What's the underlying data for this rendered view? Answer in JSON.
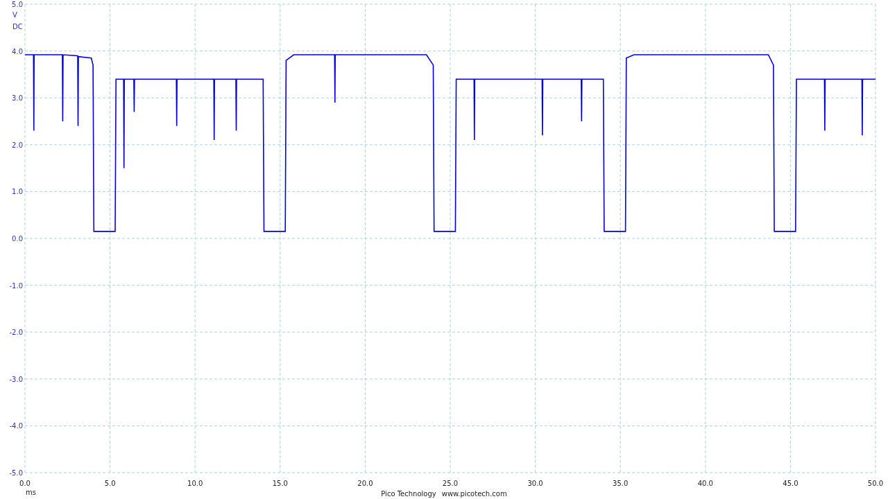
{
  "scope": {
    "coupling": "DC",
    "chart_data": {
      "type": "line",
      "grid": true,
      "xlabel": "ms",
      "ylabel": "V",
      "xlim": [
        0,
        50
      ],
      "ylim": [
        -5,
        5
      ],
      "xticks": [
        {
          "value": 0,
          "label": "0.0"
        },
        {
          "value": 5,
          "label": "5.0"
        },
        {
          "value": 10,
          "label": "10.0"
        },
        {
          "value": 15,
          "label": "15.0"
        },
        {
          "value": 20,
          "label": "20.0"
        },
        {
          "value": 25,
          "label": "25.0"
        },
        {
          "value": 30,
          "label": "30.0"
        },
        {
          "value": 35,
          "label": "35.0"
        },
        {
          "value": 40,
          "label": "40.0"
        },
        {
          "value": 45,
          "label": "45.0"
        },
        {
          "value": 50,
          "label": "50.0"
        }
      ],
      "yticks": [
        {
          "value": 5,
          "label": "5.0"
        },
        {
          "value": 4,
          "label": "4.0"
        },
        {
          "value": 3,
          "label": "3.0"
        },
        {
          "value": 2,
          "label": "2.0"
        },
        {
          "value": 1,
          "label": "1.0"
        },
        {
          "value": 0,
          "label": "0.0"
        },
        {
          "value": -1,
          "label": "-1.0"
        },
        {
          "value": -2,
          "label": "-2.0"
        },
        {
          "value": -3,
          "label": "-3.0"
        },
        {
          "value": -4,
          "label": "-4.0"
        },
        {
          "value": -5,
          "label": "-5.0"
        }
      ],
      "x": [
        0,
        0.5,
        0.52,
        0.54,
        2.2,
        2.22,
        2.24,
        3.1,
        3.12,
        3.14,
        3.9,
        4.0,
        4.05,
        5.3,
        5.35,
        5.8,
        5.82,
        5.84,
        6.4,
        6.42,
        6.44,
        8.9,
        8.92,
        8.94,
        11.1,
        11.12,
        11.14,
        12.4,
        12.42,
        12.44,
        14.0,
        14.05,
        15.3,
        15.35,
        15.8,
        18.2,
        18.22,
        18.24,
        23.6,
        24.0,
        24.05,
        25.3,
        25.35,
        26.4,
        26.42,
        26.44,
        30.4,
        30.42,
        30.44,
        32.7,
        32.72,
        32.74,
        34.0,
        34.05,
        35.3,
        35.35,
        35.8,
        43.7,
        44.0,
        44.05,
        45.3,
        45.35,
        47.0,
        47.02,
        47.04,
        49.2,
        49.22,
        49.24,
        50
      ],
      "series": [
        {
          "color": "#0000e0",
          "values": [
            3.92,
            3.92,
            2.3,
            3.92,
            3.92,
            2.5,
            3.92,
            3.9,
            2.4,
            3.88,
            3.85,
            3.7,
            0.15,
            0.15,
            3.4,
            3.4,
            1.5,
            3.4,
            3.4,
            2.7,
            3.4,
            3.4,
            2.4,
            3.4,
            3.4,
            2.1,
            3.4,
            3.4,
            2.3,
            3.4,
            3.4,
            0.15,
            0.15,
            3.8,
            3.92,
            3.92,
            2.9,
            3.92,
            3.92,
            3.7,
            0.15,
            0.15,
            3.4,
            3.4,
            2.1,
            3.4,
            3.4,
            2.2,
            3.4,
            3.4,
            2.5,
            3.4,
            3.4,
            0.15,
            0.15,
            3.85,
            3.92,
            3.92,
            3.7,
            0.15,
            0.15,
            3.4,
            3.4,
            2.3,
            3.4,
            3.4,
            2.2,
            3.4,
            3.4
          ]
        }
      ]
    }
  },
  "footer": {
    "company": "Pico Technology",
    "website": "www.picotech.com"
  }
}
